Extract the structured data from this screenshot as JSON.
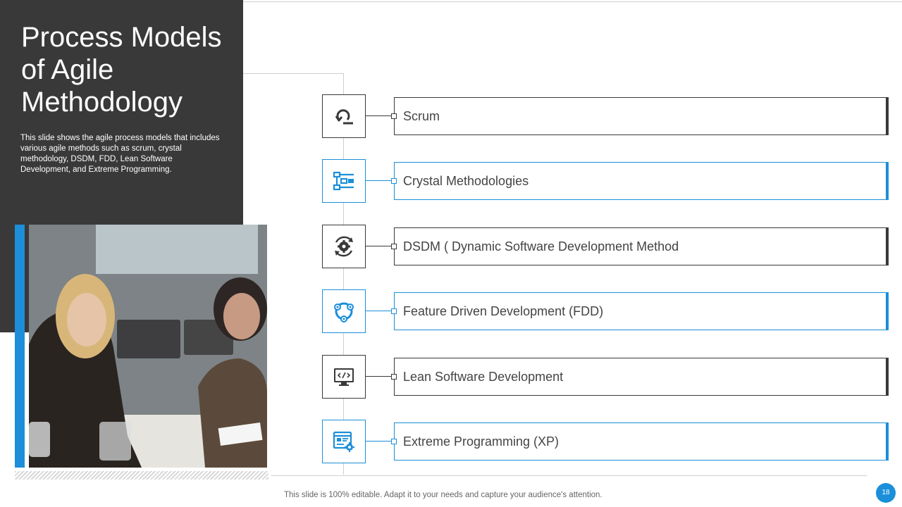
{
  "slide": {
    "title": "Process Models of Agile Methodology",
    "description": "This slide shows the agile process models that includes various agile methods such as scrum, crystal methodology, DSDM, FDD, Lean Software Development, and Extreme Programming.",
    "footer_note": "This slide is 100% editable. Adapt it to your needs and capture your audience's attention.",
    "page_number": "18"
  },
  "colors": {
    "dark": "#3a3939",
    "accent": "#1b8fd9"
  },
  "process_models": [
    {
      "label": "Scrum",
      "icon": "scrum-cycle-icon",
      "style": "dark"
    },
    {
      "label": "Crystal Methodologies",
      "icon": "flowchart-icon",
      "style": "blue"
    },
    {
      "label": "DSDM ( Dynamic Software Development Method",
      "icon": "gear-cycle-icon",
      "style": "dark"
    },
    {
      "label": "Feature Driven Development (FDD)",
      "icon": "cycle-nodes-icon",
      "style": "blue"
    },
    {
      "label": "Lean Software Development",
      "icon": "code-monitor-icon",
      "style": "dark"
    },
    {
      "label": "Extreme Programming (XP)",
      "icon": "browser-gear-icon",
      "style": "blue"
    }
  ]
}
